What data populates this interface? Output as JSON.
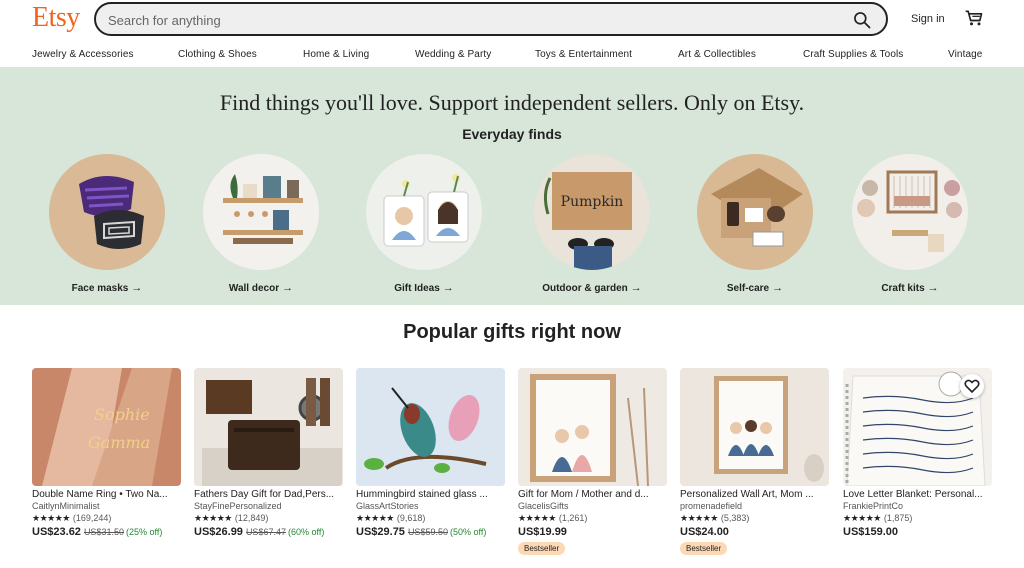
{
  "header": {
    "logo": "Etsy",
    "search_placeholder": "Search for anything",
    "signin": "Sign in"
  },
  "categories": [
    "Jewelry & Accessories",
    "Clothing & Shoes",
    "Home & Living",
    "Wedding & Party",
    "Toys & Entertainment",
    "Art & Collectibles",
    "Craft Supplies & Tools",
    "Vintage"
  ],
  "hero": {
    "title": "Find things you'll love. Support independent sellers. Only on Etsy.",
    "subtitle": "Everyday finds",
    "items": [
      {
        "label": "Face masks"
      },
      {
        "label": "Wall decor"
      },
      {
        "label": "Gift Ideas"
      },
      {
        "label": "Outdoor & garden"
      },
      {
        "label": "Self-care"
      },
      {
        "label": "Craft kits"
      }
    ],
    "arrow": "→"
  },
  "popular": {
    "title": "Popular gifts right now",
    "products": [
      {
        "title": "Double Name Ring • Two Na...",
        "shop": "CaitlynMinimalist",
        "stars": "★★★★★",
        "count": "(169,244)",
        "price": "US$23.62",
        "orig": "US$31.50",
        "disc": "(25% off)",
        "badge": ""
      },
      {
        "title": "Fathers Day Gift for Dad,Pers...",
        "shop": "StayFinePersonalized",
        "stars": "★★★★★",
        "count": "(12,849)",
        "price": "US$26.99",
        "orig": "US$67.47",
        "disc": "(60% off)",
        "badge": ""
      },
      {
        "title": "Hummingbird stained glass ...",
        "shop": "GlassArtStories",
        "stars": "★★★★★",
        "count": "(9,618)",
        "price": "US$29.75",
        "orig": "US$59.50",
        "disc": "(50% off)",
        "badge": ""
      },
      {
        "title": "Gift for Mom / Mother and d...",
        "shop": "GlacelisGifts",
        "stars": "★★★★★",
        "count": "(1,261)",
        "price": "US$19.99",
        "orig": "",
        "disc": "",
        "badge": "Bestseller"
      },
      {
        "title": "Personalized Wall Art, Mom ...",
        "shop": "promenadefield",
        "stars": "★★★★★",
        "count": "(5,383)",
        "price": "US$24.00",
        "orig": "",
        "disc": "",
        "badge": "Bestseller"
      },
      {
        "title": "Love Letter Blanket: Personal...",
        "shop": "FrankiePrintCo",
        "stars": "★★★★★",
        "count": "(1,875)",
        "price": "US$159.00",
        "orig": "",
        "disc": "",
        "badge": ""
      }
    ]
  },
  "colors": {
    "brand": "#f1641e",
    "hero_bg": "#d7e6d8",
    "badge": "#fdd8b5",
    "discount": "#258635"
  }
}
